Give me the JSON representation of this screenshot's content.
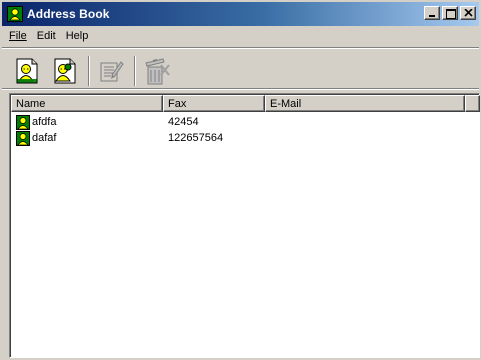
{
  "window": {
    "title": "Address Book",
    "app_icon": "address-book-icon"
  },
  "caption_buttons": [
    "minimize",
    "maximize",
    "close"
  ],
  "menu": {
    "items": [
      {
        "label": "File",
        "mnemonic": "F"
      },
      {
        "label": "Edit",
        "mnemonic": "E"
      },
      {
        "label": "Help",
        "mnemonic": "H"
      }
    ]
  },
  "toolbar": {
    "buttons": [
      {
        "icon": "new-contact-icon",
        "enabled": true
      },
      {
        "icon": "new-group-icon",
        "enabled": true
      },
      {
        "icon": "edit-entry-icon",
        "enabled": false
      },
      {
        "icon": "delete-entry-icon",
        "enabled": false
      }
    ]
  },
  "list": {
    "columns": [
      "Name",
      "Fax",
      "E-Mail"
    ],
    "rows": [
      {
        "icon": "contact-icon",
        "name": "afdfa",
        "fax": "42454",
        "email": ""
      },
      {
        "icon": "contact-icon",
        "name": "dafaf",
        "fax": "122657564",
        "email": ""
      }
    ]
  },
  "colors": {
    "titlebar_start": "#0a246a",
    "titlebar_end": "#a6caf0",
    "face": "#d4d0c8",
    "icon_yellow": "#ffff00",
    "icon_green": "#008000"
  }
}
